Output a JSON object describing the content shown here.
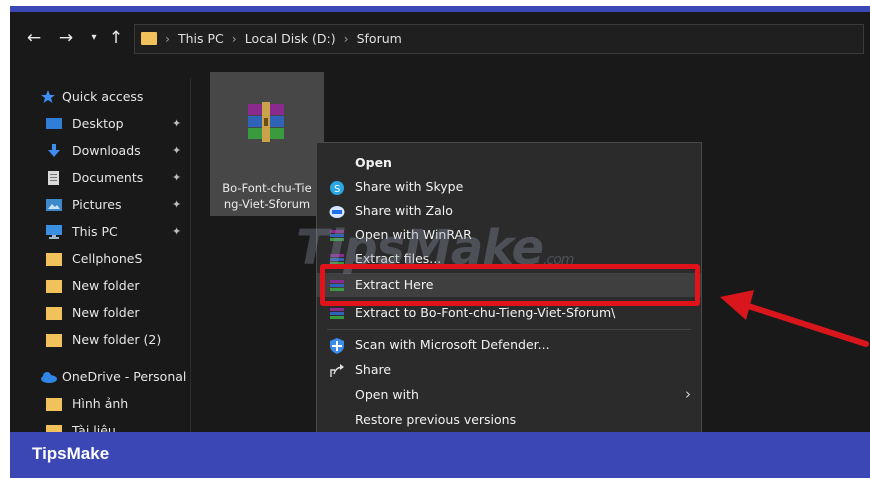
{
  "address_bar": {
    "back_icon": "arrow-left-icon",
    "forward_icon": "arrow-right-icon",
    "up_icon": "arrow-up-icon",
    "path": [
      "This PC",
      "Local Disk (D:)",
      "Sforum"
    ]
  },
  "sidebar": {
    "items": [
      {
        "label": "Quick access",
        "icon": "star-icon",
        "pinned": false
      },
      {
        "label": "Desktop",
        "icon": "desktop-icon",
        "pinned": true
      },
      {
        "label": "Downloads",
        "icon": "download-icon",
        "pinned": true
      },
      {
        "label": "Documents",
        "icon": "document-icon",
        "pinned": true
      },
      {
        "label": "Pictures",
        "icon": "pictures-icon",
        "pinned": true
      },
      {
        "label": "This PC",
        "icon": "computer-icon",
        "pinned": true
      },
      {
        "label": "CellphoneS",
        "icon": "folder-icon",
        "pinned": false
      },
      {
        "label": "New folder",
        "icon": "folder-icon",
        "pinned": false
      },
      {
        "label": "New folder",
        "icon": "folder-icon",
        "pinned": false
      },
      {
        "label": "New folder (2)",
        "icon": "folder-icon",
        "pinned": false
      },
      {
        "label": "OneDrive - Personal",
        "icon": "cloud-icon",
        "pinned": false
      },
      {
        "label": "Hình ảnh",
        "icon": "folder-icon",
        "pinned": false
      },
      {
        "label": "Tài liệu",
        "icon": "folder-icon",
        "pinned": false
      }
    ]
  },
  "file": {
    "name_line1": "Bo-Font-chu-Tie",
    "name_line2": "ng-Viet-Sforum",
    "icon": "winrar-archive-icon"
  },
  "context_menu": {
    "items": [
      {
        "label": "Open",
        "icon": "",
        "style": "bold"
      },
      {
        "label": "Share with Skype",
        "icon": "skype-icon"
      },
      {
        "label": "Share with Zalo",
        "icon": "zalo-icon"
      },
      {
        "label": "Open with WinRAR",
        "icon": "winrar-icon"
      },
      {
        "label": "Extract files...",
        "icon": "winrar-icon"
      },
      {
        "label": "Extract Here",
        "icon": "winrar-icon"
      },
      {
        "label": "Extract to Bo-Font-chu-Tieng-Viet-Sforum\\",
        "icon": "winrar-icon"
      },
      {
        "label": "Scan with Microsoft Defender...",
        "icon": "defender-shield-icon"
      },
      {
        "label": "Share",
        "icon": "share-icon"
      },
      {
        "label": "Open with",
        "icon": "",
        "submenu": true
      },
      {
        "label": "Restore previous versions",
        "icon": ""
      }
    ]
  },
  "watermark": {
    "text": "TipsMake",
    "suffix": ".com"
  },
  "footer": {
    "brand": "TipsMake"
  },
  "colors": {
    "highlight": "#e0131a",
    "brand_bar": "#3b47b5",
    "explorer_bg": "#191919",
    "menu_bg": "#2b2b2b"
  }
}
